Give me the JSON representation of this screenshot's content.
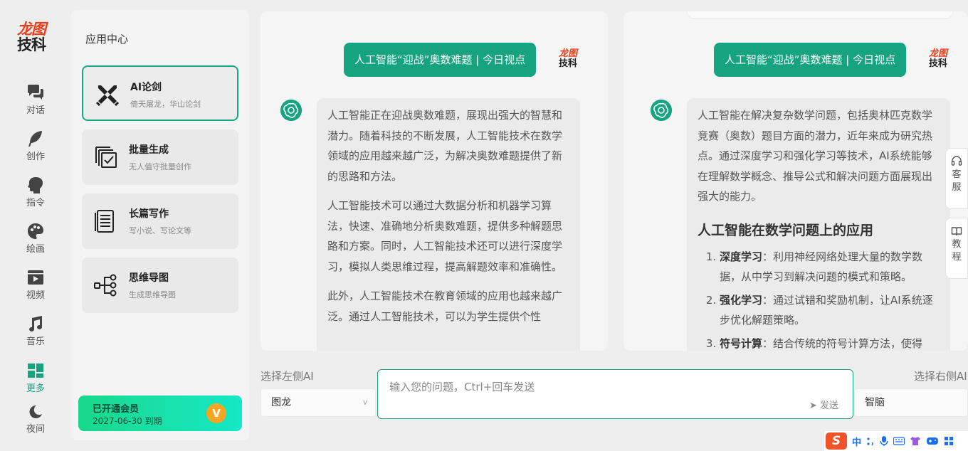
{
  "brand": {
    "line1": "龙图",
    "line2": "技科"
  },
  "nav": {
    "items": [
      {
        "label": "对话"
      },
      {
        "label": "创作"
      },
      {
        "label": "指令"
      },
      {
        "label": "绘画"
      },
      {
        "label": "视频"
      },
      {
        "label": "音乐"
      },
      {
        "label": "更多"
      },
      {
        "label": "夜间"
      }
    ]
  },
  "apps": {
    "title": "应用中心",
    "cards": [
      {
        "title": "AI论剑",
        "subtitle": "倚天屠龙，华山论剑",
        "icon": "crossed-swords-icon"
      },
      {
        "title": "批量生成",
        "subtitle": "无人值守批量创作",
        "icon": "batch-copy-icon"
      },
      {
        "title": "长篇写作",
        "subtitle": "写小说、写论文等",
        "icon": "scroll-document-icon"
      },
      {
        "title": "思维导图",
        "subtitle": "生成思维导图",
        "icon": "mind-map-icon"
      }
    ],
    "membership": {
      "title": "已开通会员",
      "expiry": "2027-06-30 到期",
      "badge": "V"
    }
  },
  "chat_left": {
    "question": "人工智能“迎战”奥数难题 | 今日视点",
    "paragraphs": [
      "人工智能正在迎战奥数难题，展现出强大的智慧和潜力。随着科技的不断发展，人工智能技术在数学领域的应用越来越广泛，为解决奥数难题提供了新的思路和方法。",
      "人工智能技术可以通过大数据分析和机器学习算法，快速、准确地分析奥数难题，提供多种解题思路和方案。同时，人工智能技术还可以进行深度学习，模拟人类思维过程，提高解题效率和准确性。",
      "此外，人工智能技术在教育领域的应用也越来越广泛。通过人工智能技术，可以为学生提供个性"
    ]
  },
  "chat_right": {
    "question": "人工智能“迎战”奥数难题 | 今日视点",
    "intro": "人工智能在解决复杂数学问题，包括奥林匹克数学竞赛（奥数）题目方面的潜力，近年来成为研究热点。通过深度学习和强化学习等技术，AI系统能够在理解数学概念、推导公式和解决问题方面展现出强大的能力。",
    "heading": "人工智能在数学问题上的应用",
    "list": [
      {
        "term": "深度学习",
        "text": "：利用神经网络处理大量的数学数据，从中学习到解决问题的模式和策略。"
      },
      {
        "term": "强化学习",
        "text": "：通过试错和奖励机制，让AI系统逐步优化解题策略。"
      },
      {
        "term": "符号计算",
        "text": "：结合传统的符号计算方法，使得"
      }
    ]
  },
  "float_buttons": {
    "service": "客服",
    "tutorial": "教程"
  },
  "bottom": {
    "left_label": "选择左侧AI",
    "left_value": "图龙",
    "right_label": "选择右侧AI",
    "right_value": "智脑",
    "input_placeholder": "输入您的问题，Ctrl+回车发送",
    "send_label": "发送"
  },
  "ime": {
    "logo": "S",
    "mode": "中"
  },
  "colors": {
    "accent": "#16a37f",
    "brand_red": "#e8401c",
    "member_gradient_start": "#19d88a",
    "member_gradient_end": "#16e8c6"
  }
}
